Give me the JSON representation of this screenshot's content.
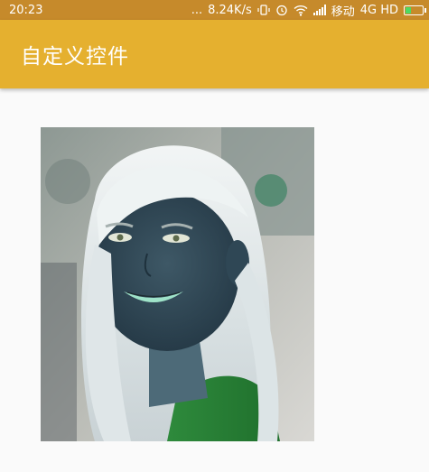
{
  "status_bar": {
    "time": "20:23",
    "dots": "...",
    "speed": "8.24K/s",
    "carrier": "移动",
    "network": "4G HD",
    "icons": [
      "vibrate-icon",
      "alarm-icon",
      "wifi-icon",
      "signal-icon",
      "battery-icon"
    ]
  },
  "app_bar": {
    "title": "自定义控件"
  },
  "image": {
    "description_icon": "inverted-portrait-image"
  },
  "colors": {
    "status_bar": "#c68a2b",
    "app_bar": "#e5b02f",
    "background": "#fafafa"
  }
}
